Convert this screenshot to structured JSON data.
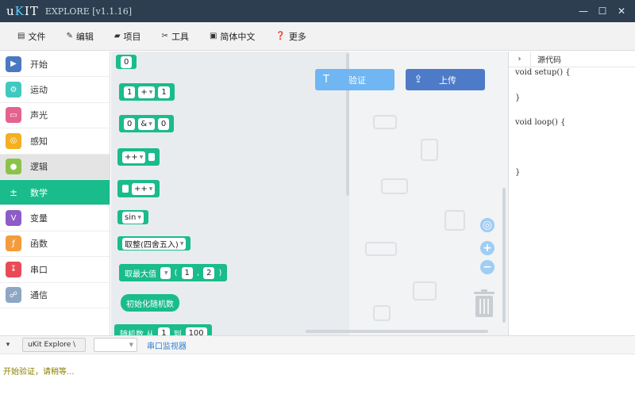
{
  "titlebar": {
    "logo": "uKIT",
    "title": "EXPLORE [v1.1.16]",
    "minimize": "—",
    "maximize": "☐",
    "close": "✕"
  },
  "menu": {
    "items": [
      {
        "icon": "file-icon",
        "glyph": "▤",
        "label": "文件"
      },
      {
        "icon": "edit-icon",
        "glyph": "✎",
        "label": "编辑"
      },
      {
        "icon": "folder-icon",
        "glyph": "▰",
        "label": "项目"
      },
      {
        "icon": "tool-icon",
        "glyph": "✂",
        "label": "工具"
      },
      {
        "icon": "keyboard-icon",
        "glyph": "▣",
        "label": "简体中文"
      },
      {
        "icon": "help-icon",
        "glyph": "❓",
        "label": "更多"
      }
    ]
  },
  "categories": [
    {
      "label": "开始",
      "color": "#4a78c2",
      "glyph": "▶"
    },
    {
      "label": "运动",
      "color": "#3fc9c0",
      "glyph": "⚙"
    },
    {
      "label": "声光",
      "color": "#e5628f",
      "glyph": "▭"
    },
    {
      "label": "感知",
      "color": "#f3b021",
      "glyph": "◎"
    },
    {
      "label": "逻辑",
      "color": "#8bc34a",
      "glyph": "●"
    },
    {
      "label": "数学",
      "color": "#1abc8c",
      "glyph": "±"
    },
    {
      "label": "变量",
      "color": "#8d5cc9",
      "glyph": "V"
    },
    {
      "label": "函数",
      "color": "#f39c3d",
      "glyph": "ƒ"
    },
    {
      "label": "串口",
      "color": "#e94b56",
      "glyph": "↧"
    },
    {
      "label": "通信",
      "color": "#8ea6c4",
      "glyph": "☍"
    }
  ],
  "blocks": {
    "zero": "0",
    "add": {
      "a": "1",
      "op": "+",
      "b": "1"
    },
    "and": {
      "a": "0",
      "op": "&",
      "b": "0"
    },
    "inc_post": "++",
    "inc_pre": "++",
    "sin": "sin",
    "round": "取整(四舍五入)",
    "max": {
      "fn": "取最大值",
      "lp": "(",
      "a": "1",
      "comma": ",",
      "b": "2",
      "rp": ")"
    },
    "init_random": "初始化随机数",
    "random": {
      "from": "随机数 从",
      "a": "1",
      "to": "到",
      "b": "100"
    }
  },
  "workspace": {
    "verify_label": "验证",
    "upload_label": "上传"
  },
  "code": {
    "header": "源代码",
    "lines": [
      "void setup() {",
      "",
      "",
      "}",
      "",
      "",
      "void loop() {",
      "",
      "",
      "",
      "",
      "",
      "}"
    ]
  },
  "bottom": {
    "port": "uKit Explore \\",
    "serial_monitor": "串口监视器"
  },
  "console": {
    "message": "开始验证，请稍等..."
  }
}
